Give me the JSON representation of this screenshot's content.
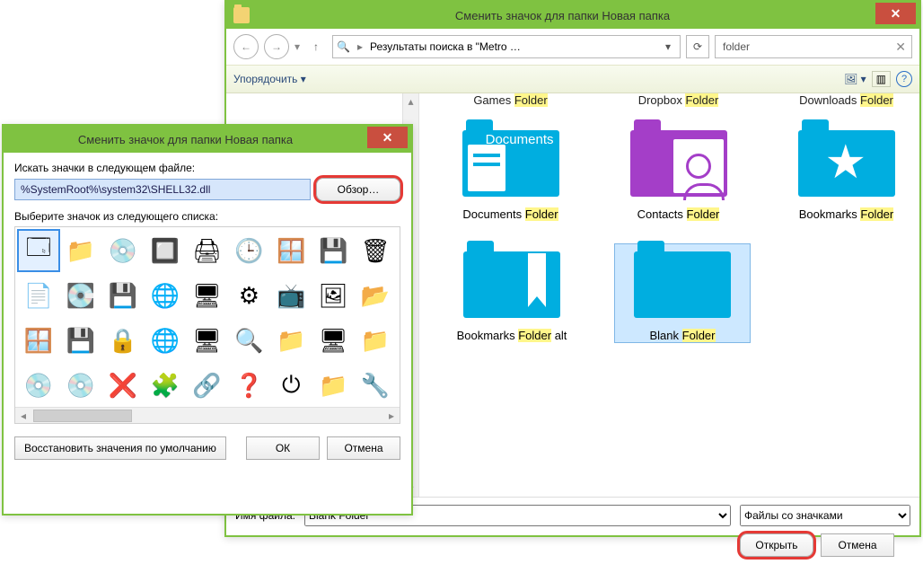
{
  "big": {
    "title": "Сменить значок для папки Новая папка",
    "breadcrumb": "Результаты поиска в \"Metro …",
    "search": {
      "value": "folder"
    },
    "toolbar": {
      "organize": "Упорядочить"
    },
    "truncated_row": [
      {
        "pre": "Games ",
        "hl": "Folder"
      },
      {
        "pre": "Dropbox ",
        "hl": "Folder"
      },
      {
        "pre": "Downloads ",
        "hl": "Folder"
      }
    ],
    "items_row1": [
      {
        "id": "documents",
        "label_pre": "Documents ",
        "label_hl": "Folder",
        "title_in_icon": "Documents"
      },
      {
        "id": "contacts",
        "label_pre": "Contacts ",
        "label_hl": "Folder"
      },
      {
        "id": "bookmarks",
        "label_pre": "Bookmarks ",
        "label_hl": "Folder"
      }
    ],
    "items_row2": [
      {
        "id": "bookmarks-alt",
        "label_pre": "Bookmarks ",
        "label_hl": "Folder",
        "label_post": " alt"
      },
      {
        "id": "blank",
        "label_pre": "Blank ",
        "label_hl": "Folder",
        "selected": true
      }
    ],
    "footer": {
      "filename_label": "Имя файла:",
      "filename_value": "Blank Folder",
      "filter_value": "Файлы со значками",
      "open": "Открыть",
      "cancel": "Отмена"
    }
  },
  "small": {
    "title": "Сменить значок для папки Новая папка",
    "seek_label": "Искать значки в следующем файле:",
    "path_value": "%SystemRoot%\\system32\\SHELL32.dll",
    "browse": "Обзор…",
    "list_label": "Выберите значок из следующего списка:",
    "reset": "Восстановить значения по умолчанию",
    "ok": "ОК",
    "cancel": "Отмена",
    "icons": [
      "🗔",
      "📁",
      "💿",
      "🔲",
      "🖨",
      "🕒",
      "🪟",
      "💾",
      "🗑",
      "📄",
      "💽",
      "💾",
      "🌐",
      "🖥",
      "⚙",
      "📺",
      "🖼",
      "📂",
      "🪟",
      "💾",
      "🔒",
      "🌐",
      "🖥",
      "🔍",
      "📁",
      "🖥",
      "📁",
      "💿",
      "💿",
      "❌",
      "🧩",
      "🔗",
      "❓",
      "⏻",
      "📁",
      "🔧"
    ]
  }
}
